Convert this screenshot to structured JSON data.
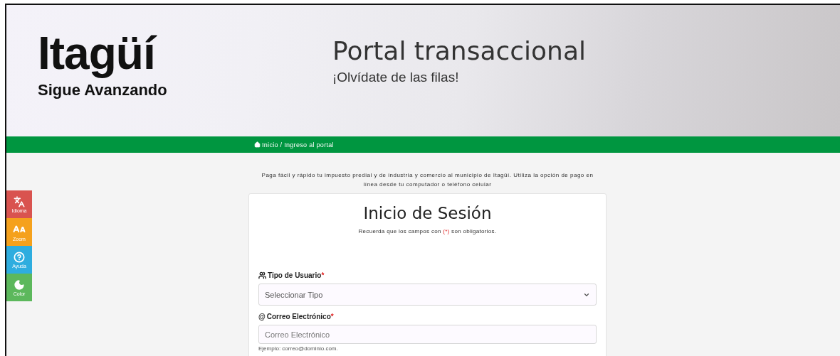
{
  "header": {
    "logo_word": "Itagüí",
    "logo_tagline": "Sigue Avanzando",
    "title": "Portal transaccional",
    "subtitle": "¡Olvídate de las filas!"
  },
  "breadcrumb": {
    "text": "Inicio / Ingreso al portal"
  },
  "intro": "Paga fácil y rápido tu impuesto predial y de industria y comercio al municipio de Itagüí. Utiliza la opción de pago en línea desde tu computador o teléfono celular",
  "side_tools": [
    {
      "kind": "language",
      "label": "Idioma",
      "color": "#d9534f"
    },
    {
      "kind": "zoom",
      "label": "Zoom",
      "color": "#f5a11c"
    },
    {
      "kind": "help",
      "label": "Ayuda",
      "color": "#2eaddf"
    },
    {
      "kind": "color",
      "label": "Color",
      "color": "#5cb85c"
    }
  ],
  "login": {
    "title": "Inicio de Sesión",
    "note_before": "Recuerda que los campos con ",
    "note_mark": "(*)",
    "note_after": " son obligatorios.",
    "fields": [
      {
        "kind": "select",
        "label": "Tipo de Usuario",
        "required_mark": "*",
        "placeholder": "Seleccionar Tipo"
      },
      {
        "kind": "input",
        "icon_text": "@",
        "label": "Correo Electrónico",
        "required_mark": "*",
        "placeholder": "Correo Electrónico",
        "hint": "Ejemplo: correo@dominio.com."
      }
    ]
  }
}
